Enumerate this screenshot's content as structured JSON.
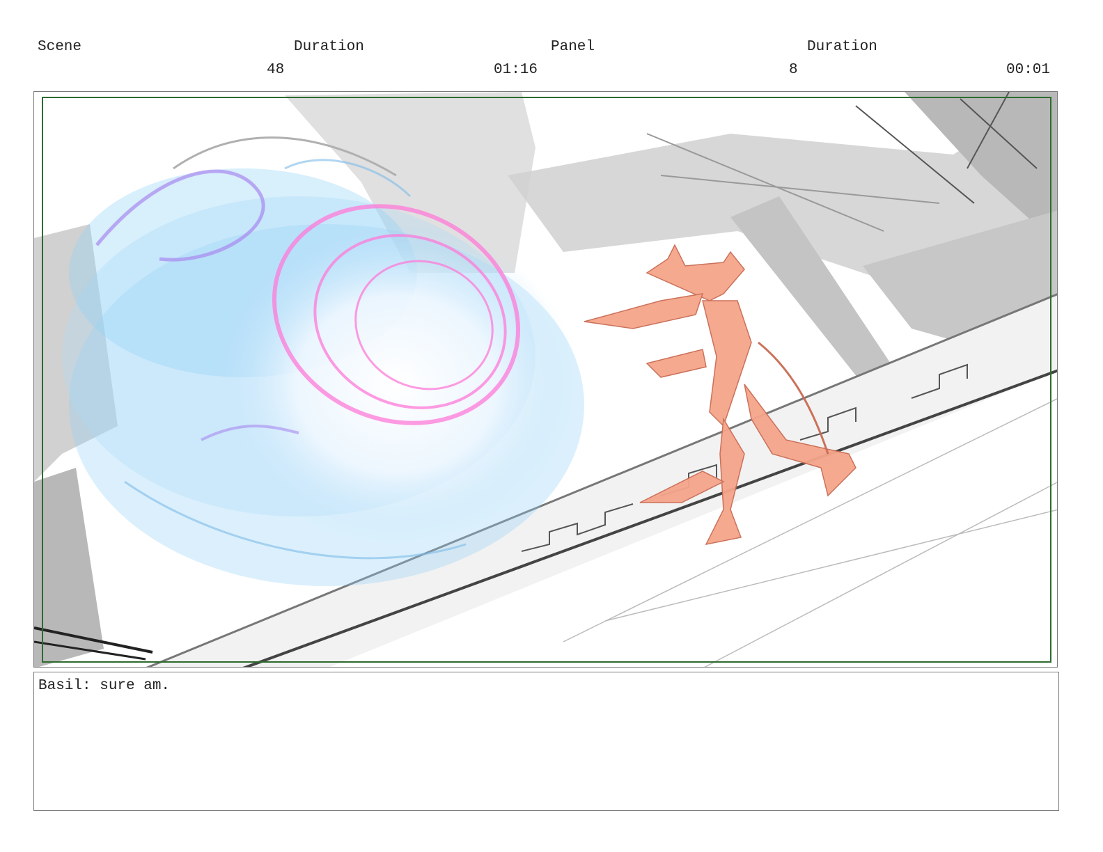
{
  "header": {
    "scene_label": "Scene",
    "scene_duration_label": "Duration",
    "panel_label": "Panel",
    "panel_duration_label": "Duration",
    "scene_value": "48",
    "scene_duration_value": "01:16",
    "panel_value": "8",
    "panel_duration_value": "00:01"
  },
  "panel": {
    "safe_area_color": "#2e6b2e",
    "energy_color": "#8fd0f5",
    "ring_color": "#ff7ad9",
    "character_color": "#f5a58a"
  },
  "dialogue": {
    "text": "Basil: sure am."
  }
}
